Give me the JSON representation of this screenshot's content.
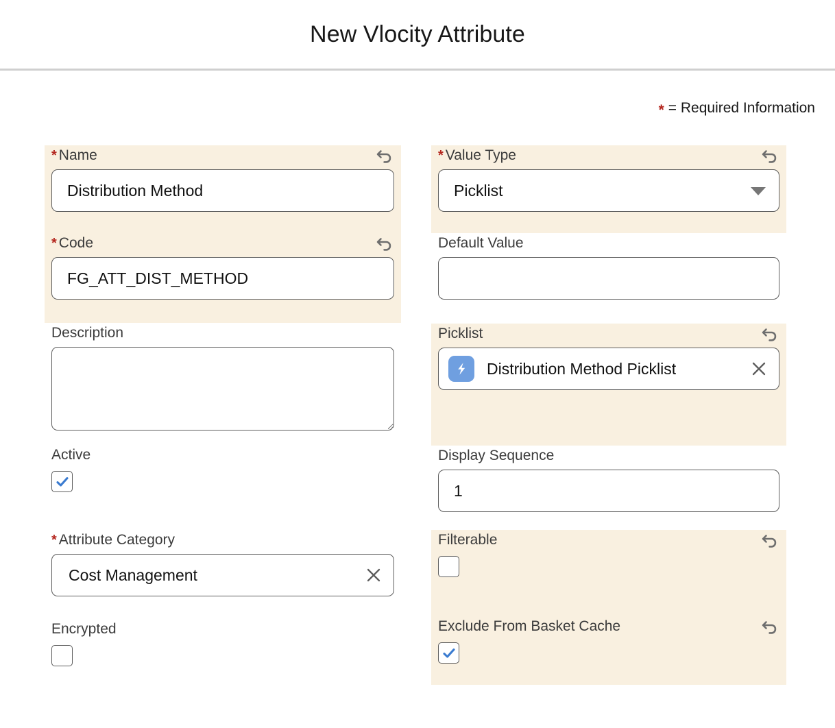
{
  "header": {
    "title": "New Vlocity Attribute"
  },
  "legend": {
    "star": "*",
    "text": "= Required Information"
  },
  "colors": {
    "highlight_bg": "#f9f0e0",
    "required_star": "#b4261e",
    "checkbox_check": "#3a7bd0",
    "record_icon_bg": "#6f9fe0",
    "divider": "#cfcfcf"
  },
  "left_column": [
    {
      "key": "name",
      "label": "Name",
      "required": true,
      "highlighted": true,
      "has_undo": true,
      "control": "text",
      "value": "Distribution Method",
      "placeholder": ""
    },
    {
      "key": "code",
      "label": "Code",
      "required": true,
      "highlighted": true,
      "has_undo": true,
      "control": "text",
      "value": "FG_ATT_DIST_METHOD",
      "placeholder": ""
    },
    {
      "key": "description",
      "label": "Description",
      "required": false,
      "highlighted": false,
      "has_undo": false,
      "control": "textarea",
      "value": "",
      "placeholder": ""
    },
    {
      "key": "active",
      "label": "Active",
      "required": false,
      "highlighted": false,
      "has_undo": false,
      "control": "checkbox",
      "checked": true
    },
    {
      "key": "attribute_category",
      "label": "Attribute Category",
      "required": true,
      "highlighted": false,
      "has_undo": false,
      "control": "lookup",
      "value": "Cost Management",
      "has_record_icon": false,
      "clear_icon": "close-icon"
    },
    {
      "key": "encrypted",
      "label": "Encrypted",
      "required": false,
      "highlighted": false,
      "has_undo": false,
      "control": "checkbox",
      "checked": false
    }
  ],
  "right_column": [
    {
      "key": "value_type",
      "label": "Value Type",
      "required": true,
      "highlighted": true,
      "has_undo": true,
      "control": "select",
      "value": "Picklist",
      "caret_icon": "chevron-down-icon"
    },
    {
      "key": "default_value",
      "label": "Default Value",
      "required": false,
      "highlighted": false,
      "has_undo": false,
      "control": "text",
      "value": "",
      "placeholder": ""
    },
    {
      "key": "picklist",
      "label": "Picklist",
      "required": false,
      "highlighted": true,
      "has_undo": true,
      "control": "lookup",
      "value": "Distribution Method Picklist",
      "has_record_icon": true,
      "record_icon": "lightning-bolt-icon",
      "clear_icon": "close-icon"
    },
    {
      "key": "display_sequence",
      "label": "Display Sequence",
      "required": false,
      "highlighted": false,
      "has_undo": false,
      "control": "text",
      "value": "1",
      "placeholder": ""
    },
    {
      "key": "filterable",
      "label": "Filterable",
      "required": false,
      "highlighted": true,
      "has_undo": true,
      "control": "checkbox",
      "checked": false
    },
    {
      "key": "exclude_from_basket_cache",
      "label": "Exclude From Basket Cache",
      "required": false,
      "highlighted": true,
      "has_undo": true,
      "control": "checkbox",
      "checked": true
    }
  ]
}
